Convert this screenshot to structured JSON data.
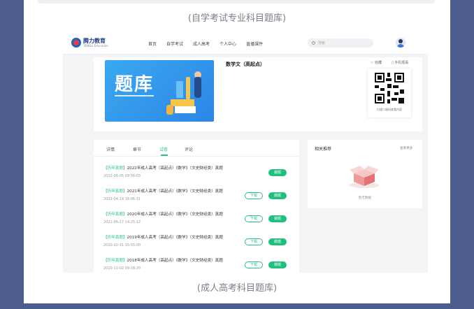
{
  "captions": {
    "top": "(自学考试专业科目题库)",
    "bottom": "(成人高考科目题库)"
  },
  "header": {
    "logo_cn": "腾力教育",
    "logo_en": "TENGLI Education",
    "nav": [
      "首页",
      "自学考试",
      "成人高考",
      "个人中心",
      "直播课件"
    ],
    "search_placeholder": "搜索"
  },
  "product": {
    "banner_text": "题库",
    "name": "数学文（高起点）",
    "favorite_label": "☆ 收藏",
    "mobile_label": "▯ 手机观看",
    "qr_caption": "扫描二维码查看内容"
  },
  "tabs": {
    "items": [
      "详情",
      "章节",
      "试卷",
      "评论"
    ],
    "active": "试卷"
  },
  "exams": [
    {
      "tag": "【历年真题】",
      "title": "2022年成人高考（高起点）《数学》（文史财经类）真题",
      "date": "2022-06-05 09:56:03",
      "download": "",
      "action": "做题"
    },
    {
      "tag": "【历年真题】",
      "title": "2021年成人高考（高起点）《数学》（文史财经类）真题",
      "date": "2022-04-14 16:06:31",
      "download": "下载",
      "action": "做题"
    },
    {
      "tag": "【历年真题】",
      "title": "2020年成人高考（高起点）《数学》（文史财经类）真题",
      "date": "2021-06-17 14:25:12",
      "download": "下载",
      "action": "做题"
    },
    {
      "tag": "【历年真题】",
      "title": "2019年成人高考（高起点）《数学》（文史财经类）真题",
      "date": "2020-10-31 15:55:00",
      "download": "下载",
      "action": "做题"
    },
    {
      "tag": "【历年真题】",
      "title": "2018年成人高考（高起点）《数学》（文史财经类）真题",
      "date": "2020-11-02 09:18:20",
      "download": "下载",
      "action": "做题"
    }
  ],
  "recommend": {
    "title": "相关推荐",
    "more": "查看更多",
    "empty_text": "暂无数据"
  },
  "colors": {
    "accent": "#1fbf7f",
    "frame": "#4c5c8f",
    "banner": "#2c86e6"
  }
}
